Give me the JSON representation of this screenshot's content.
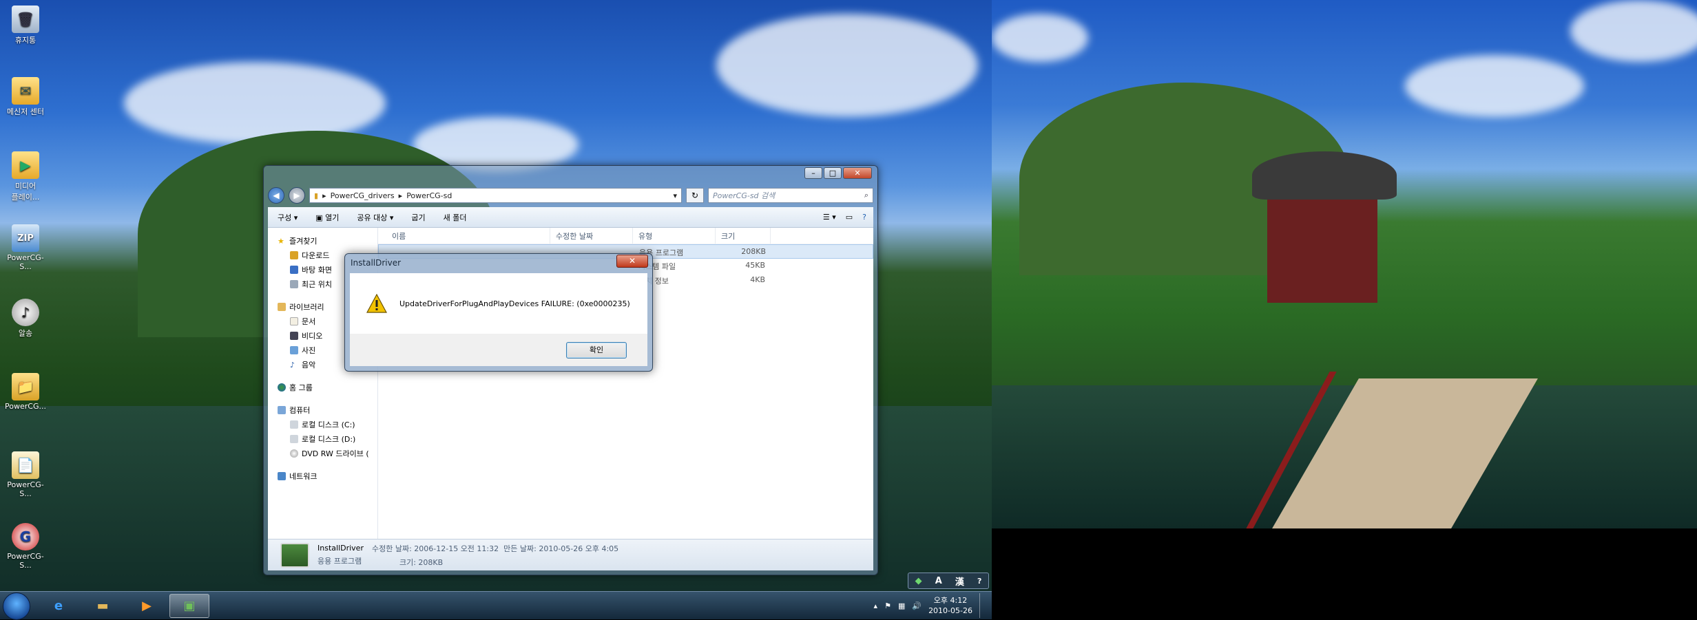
{
  "desktop": {
    "icons": [
      {
        "label": "휴지통",
        "icon": "recycle-bin-icon",
        "glyph": "🗑"
      },
      {
        "label": "메신저 센터",
        "icon": "messenger-folder-icon",
        "glyph": "✉"
      },
      {
        "label": "미디어\n플레이...",
        "icon": "media-player-icon",
        "glyph": "▶"
      },
      {
        "label": "PowerCG-S...",
        "icon": "zip-archive-icon",
        "glyph": "ZIP"
      },
      {
        "label": "알송",
        "icon": "alsong-icon",
        "glyph": "♪"
      },
      {
        "label": "PowerCG...",
        "icon": "folder-icon",
        "glyph": "📁"
      },
      {
        "label": "PowerCG-S...",
        "icon": "document-icon",
        "glyph": "📄"
      },
      {
        "label": "PowerCG-S...",
        "icon": "powercg-app-icon",
        "glyph": "G"
      }
    ]
  },
  "explorer": {
    "address": {
      "segments": [
        "PowerCG_drivers",
        "PowerCG-sd"
      ],
      "search_placeholder": "PowerCG-sd 검색"
    },
    "toolbar": {
      "organize": "구성 ▾",
      "open": "열기",
      "share": "공유 대상 ▾",
      "burn": "굽기",
      "new_folder": "새 폴더"
    },
    "nav": {
      "favorites": "즐겨찾기",
      "downloads": "다운로드",
      "desktop": "바탕 화면",
      "recent": "최근 위치",
      "libraries": "라이브러리",
      "documents": "문서",
      "videos": "비디오",
      "pictures": "사진",
      "music": "음악",
      "homegroup": "홈 그룹",
      "computer": "컴퓨터",
      "drive_c": "로컬 디스크 (C:)",
      "drive_d": "로컬 디스크 (D:)",
      "dvd": "DVD RW 드라이브 (",
      "network": "네트워크"
    },
    "columns": {
      "name": "이름",
      "modified": "수정한 날짜",
      "type": "유형",
      "size": "크기"
    },
    "files": [
      {
        "type": "응용 프로그램",
        "size": "208KB"
      },
      {
        "type": "시스템 파일",
        "size": "45KB"
      },
      {
        "type": "설치 정보",
        "size": "4KB"
      }
    ],
    "details": {
      "name": "InstallDriver",
      "kind": "응용 프로그램",
      "modified": "수정한 날짜: 2006-12-15 오전 11:32",
      "created": "만든 날짜: 2010-05-26 오후 4:05",
      "size": "크기: 208KB"
    }
  },
  "dialog": {
    "title": "InstallDriver",
    "message": "UpdateDriverForPlugAndPlayDevices FAILURE: (0xe0000235)",
    "ok": "확인"
  },
  "taskbar": {
    "time": "오후 4:12",
    "date": "2010-05-26",
    "ime": [
      "A",
      "漢"
    ]
  }
}
